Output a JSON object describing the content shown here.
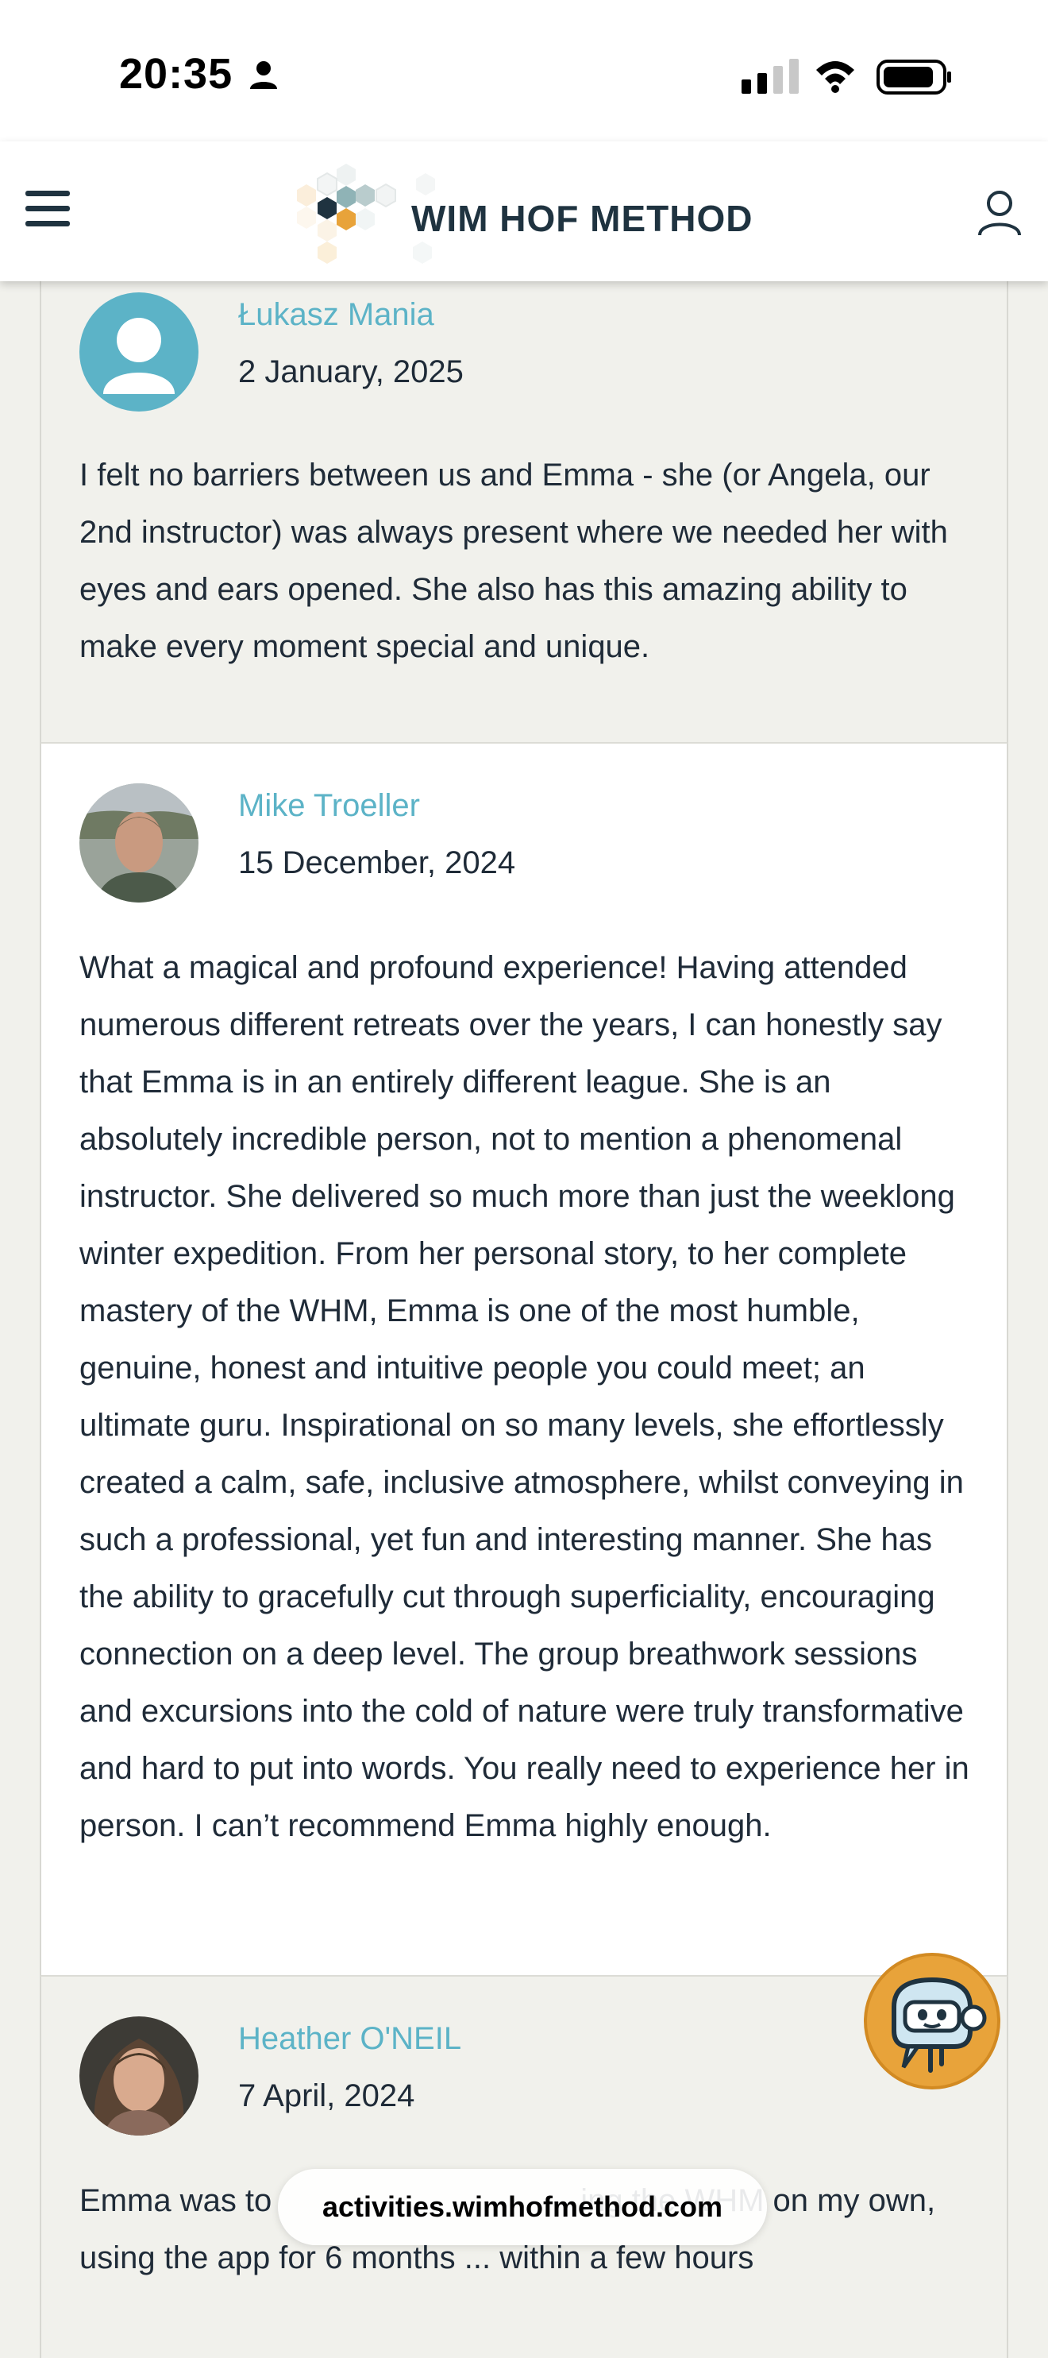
{
  "status_bar": {
    "time": "20:35"
  },
  "header": {
    "logo_text": "WIM HOF METHOD"
  },
  "reviews": [
    {
      "name": "Łukasz Mania",
      "date": "2 January, 2025",
      "text": "I felt no barriers between us and Emma - she (or Angela, our 2nd instructor) was always present where we needed her with eyes and ears opened. She also has this amazing ability to make every moment special and unique."
    },
    {
      "name": "Mike Troeller",
      "date": "15 December, 2024",
      "text": "What a magical and profound experience! Having attended numerous different retreats over the years, I can honestly say that Emma is in an entirely different league. She is an absolutely incredible person, not to mention a phenomenal instructor. She delivered so much more than just the weeklong winter expedition. From her personal story, to her complete mastery of the WHM, Emma is one of the most humble, genuine, honest and intuitive people you could meet; an ultimate guru. Inspirational on so many levels, she effortlessly created a calm, safe, inclusive atmosphere, whilst conveying in such a professional, yet fun and interesting manner. She has the ability to gracefully cut through superficiality, encouraging connection on a deep level. The group breathwork sessions and excursions into the cold of nature were truly transformative and hard to put into words. You really need to experience her in person. I can’t recommend Emma highly enough."
    },
    {
      "name": "Heather O'NEIL",
      "date": "7 April, 2024",
      "text": "Emma was to                                   ing the WHM on my own, using the app for 6 months ... within a few hours"
    }
  ],
  "browser": {
    "url": "activities.wimhofmethod.com"
  },
  "colors": {
    "accent": "#5cb3c7",
    "text": "#1f2b38",
    "logo_orange": "#e8a33a"
  }
}
